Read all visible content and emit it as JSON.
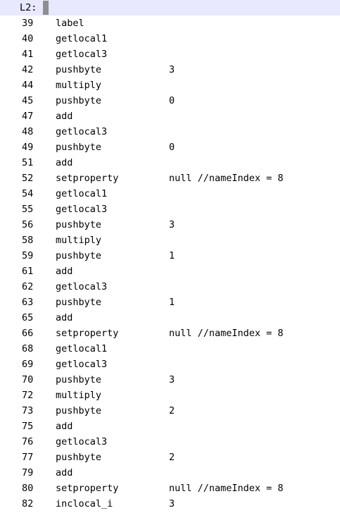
{
  "editor": {
    "current_line_label": "L2:",
    "lines": [
      {
        "num": "39",
        "op": "label",
        "arg": ""
      },
      {
        "num": "40",
        "op": "getlocal1",
        "arg": ""
      },
      {
        "num": "41",
        "op": "getlocal3",
        "arg": ""
      },
      {
        "num": "42",
        "op": "pushbyte",
        "arg": "3"
      },
      {
        "num": "44",
        "op": "multiply",
        "arg": ""
      },
      {
        "num": "45",
        "op": "pushbyte",
        "arg": "0"
      },
      {
        "num": "47",
        "op": "add",
        "arg": ""
      },
      {
        "num": "48",
        "op": "getlocal3",
        "arg": ""
      },
      {
        "num": "49",
        "op": "pushbyte",
        "arg": "0"
      },
      {
        "num": "51",
        "op": "add",
        "arg": ""
      },
      {
        "num": "52",
        "op": "setproperty",
        "arg": "null //nameIndex = 8"
      },
      {
        "num": "54",
        "op": "getlocal1",
        "arg": ""
      },
      {
        "num": "55",
        "op": "getlocal3",
        "arg": ""
      },
      {
        "num": "56",
        "op": "pushbyte",
        "arg": "3"
      },
      {
        "num": "58",
        "op": "multiply",
        "arg": ""
      },
      {
        "num": "59",
        "op": "pushbyte",
        "arg": "1"
      },
      {
        "num": "61",
        "op": "add",
        "arg": ""
      },
      {
        "num": "62",
        "op": "getlocal3",
        "arg": ""
      },
      {
        "num": "63",
        "op": "pushbyte",
        "arg": "1"
      },
      {
        "num": "65",
        "op": "add",
        "arg": ""
      },
      {
        "num": "66",
        "op": "setproperty",
        "arg": "null //nameIndex = 8"
      },
      {
        "num": "68",
        "op": "getlocal1",
        "arg": ""
      },
      {
        "num": "69",
        "op": "getlocal3",
        "arg": ""
      },
      {
        "num": "70",
        "op": "pushbyte",
        "arg": "3"
      },
      {
        "num": "72",
        "op": "multiply",
        "arg": ""
      },
      {
        "num": "73",
        "op": "pushbyte",
        "arg": "2"
      },
      {
        "num": "75",
        "op": "add",
        "arg": ""
      },
      {
        "num": "76",
        "op": "getlocal3",
        "arg": ""
      },
      {
        "num": "77",
        "op": "pushbyte",
        "arg": "2"
      },
      {
        "num": "79",
        "op": "add",
        "arg": ""
      },
      {
        "num": "80",
        "op": "setproperty",
        "arg": "null //nameIndex = 8"
      },
      {
        "num": "82",
        "op": "inclocal_i",
        "arg": "3"
      }
    ]
  }
}
